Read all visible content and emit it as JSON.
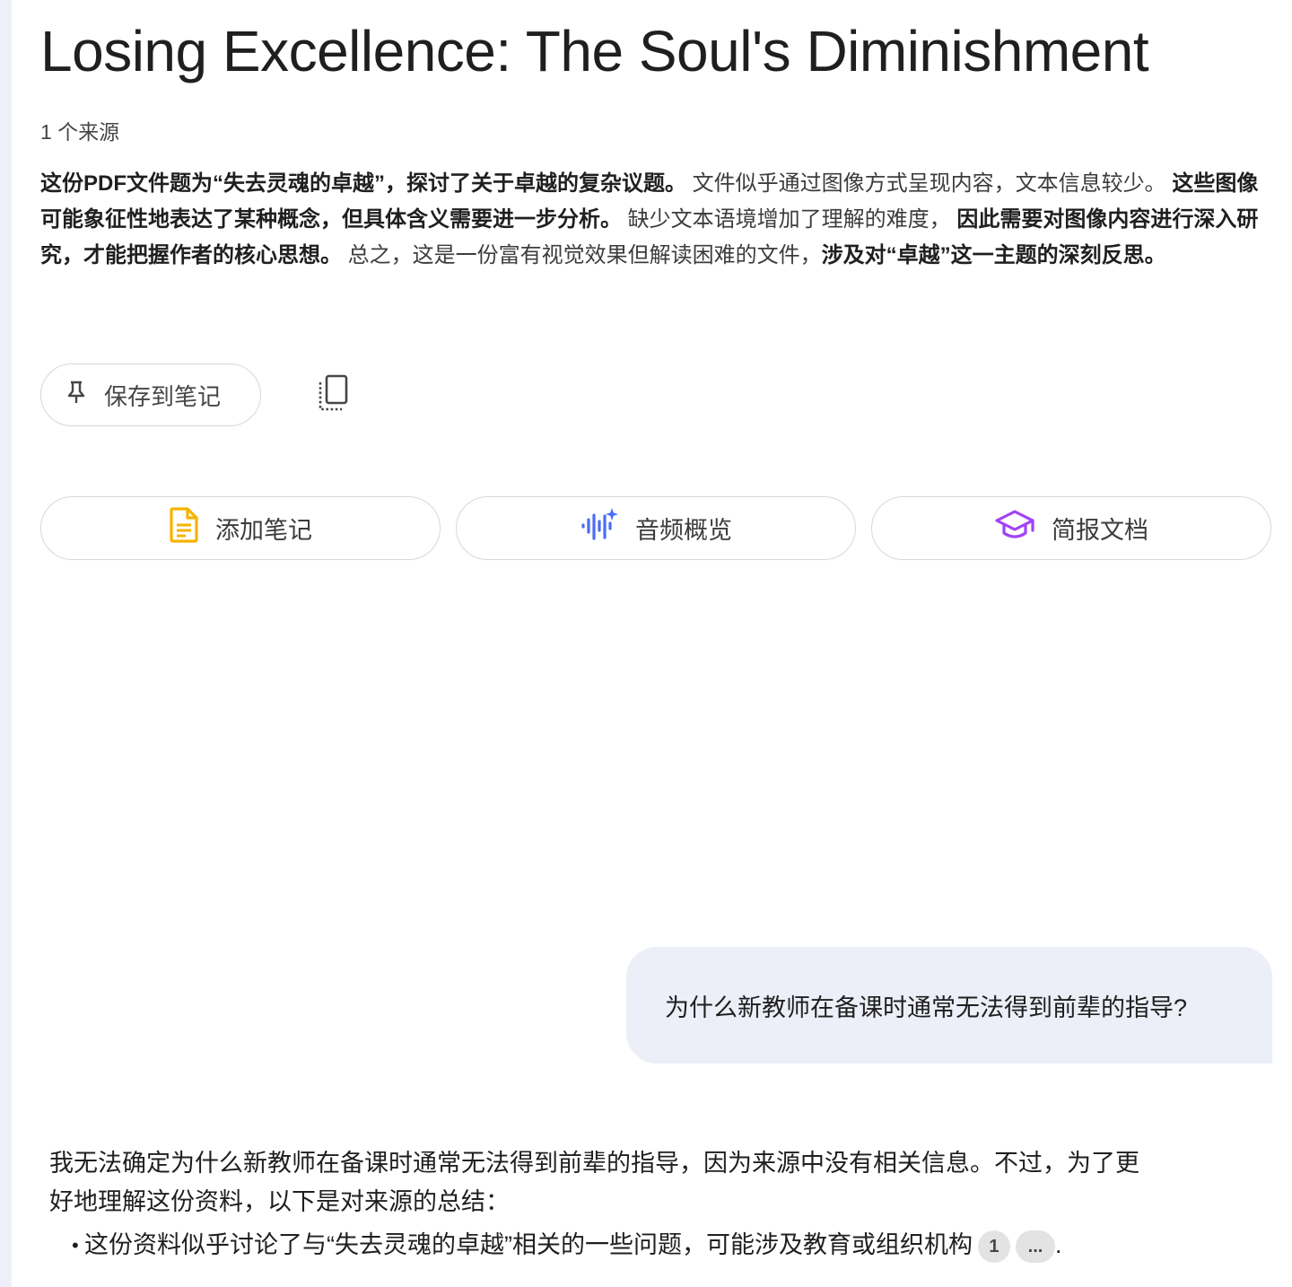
{
  "notebook": {
    "title": "Losing Excellence: The Soul's Diminishment",
    "source_count": "1 个来源"
  },
  "summary": {
    "segments": [
      {
        "text": "这份PDF文件题为“失去灵魂的卓越”，探讨了关于卓越的复杂议题。",
        "bold": true
      },
      {
        "text": " 文件似乎通过图像方式呈现内容，文本信息较少。 ",
        "bold": false
      },
      {
        "text": "这些图像可能象征性地表达了某种概念，但具体含义需要进一步分析。",
        "bold": true
      },
      {
        "text": " 缺少文本语境增加了理解的难度， ",
        "bold": false
      },
      {
        "text": "因此需要对图像内容进行深入研究，才能把握作者的核心思想。",
        "bold": true
      },
      {
        "text": " 总之，这是一份富有视觉效果但解读困难的文件，",
        "bold": false
      },
      {
        "text": "涉及对“卓越”这一主题的深刻反思。",
        "bold": true
      }
    ]
  },
  "toolbar": {
    "save_label": "保存到笔记"
  },
  "actions": {
    "add_note_label": "添加笔记",
    "audio_overview_label": "音频概览",
    "briefing_doc_label": "简报文档"
  },
  "colors": {
    "note_icon": "#f4b400",
    "audio_icon": "#4a6cf7",
    "brief_icon": "#a142f4",
    "question_bg": "#eceef8"
  },
  "chat": {
    "question": "为什么新教师在备课时通常无法得到前辈的指导?",
    "answer_intro": "我无法确定为什么新教师在备课时通常无法得到前辈的指导，因为来源中没有相关信息。不过，为了更好地理解这份资料，以下是对来源的总结：",
    "bullets": [
      {
        "text": "这份资料似乎讨论了与“失去灵魂的卓越”相关的一些问题，可能涉及教育或组织机构",
        "citation": "1",
        "more": "...",
        "trail": "."
      }
    ]
  }
}
